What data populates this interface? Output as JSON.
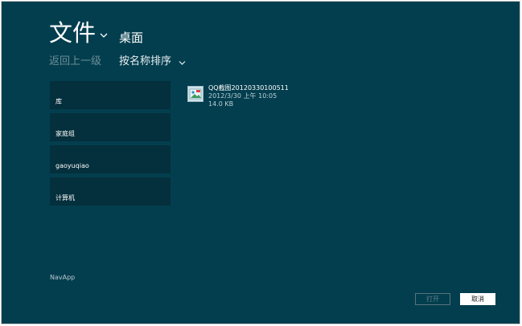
{
  "header": {
    "title": "文件",
    "location": "桌面"
  },
  "toolbar": {
    "back_label": "返回上一级",
    "sort_label": "按名称排序"
  },
  "sidebar": {
    "items": [
      {
        "label": "库"
      },
      {
        "label": "家庭组"
      },
      {
        "label": "gaoyuqiao"
      },
      {
        "label": "计算机"
      }
    ]
  },
  "files": [
    {
      "name": "QQ截图20120330100511",
      "date": "2012/3/30 上午 10:05",
      "size": "14.0 KB",
      "icon": "image-file-icon"
    }
  ],
  "footer": {
    "app_name": "NavApp",
    "open_label": "打开",
    "cancel_label": "取消"
  },
  "colors": {
    "background": "#033e4e",
    "sidebar_item": "#042f3c",
    "muted_text": "#6c8d97"
  }
}
